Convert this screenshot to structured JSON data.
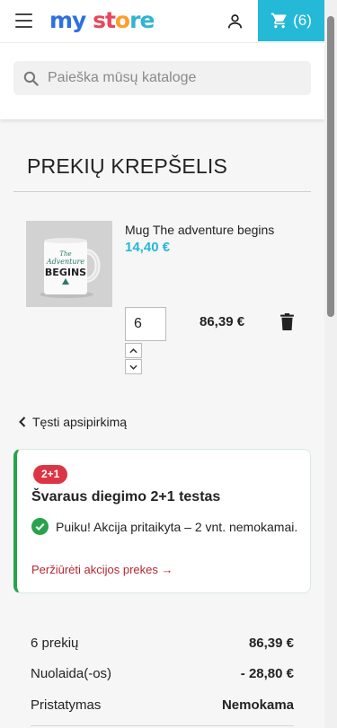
{
  "header": {
    "logo": {
      "part1": "my",
      "part2": "st",
      "part3": "o",
      "part4": "re"
    },
    "cart_count": "(6)",
    "search_placeholder": "Paieška mūsų kataloge"
  },
  "cart": {
    "title": "PREKIŲ KREPŠELIS",
    "items": [
      {
        "name": "Mug The adventure begins",
        "price": "14,40 €",
        "quantity": "6",
        "total": "86,39 €",
        "image_text": {
          "line1": "The",
          "line2": "Adventure",
          "line3": "BEGINS"
        }
      }
    ],
    "continue_label": "Tęsti apsipirkimą"
  },
  "promo": {
    "badge": "2+1",
    "title": "Švaraus diegimo 2+1 testas",
    "message": "Puiku! Akcija pritaikyta – 2 vnt. nemokamai.",
    "link": "Peržiūrėti akcijos prekes →"
  },
  "summary": {
    "rows": [
      {
        "label": "6 prekių",
        "value": "86,39 €"
      },
      {
        "label": "Nuolaida(-os)",
        "value": "- 28,80 €"
      },
      {
        "label": "Pristatymas",
        "value": "Nemokama"
      }
    ]
  },
  "colors": {
    "accent": "#24b9d7",
    "success": "#27a34b",
    "danger": "#dc3545",
    "link": "#b42632"
  },
  "icons": [
    "menu-icon",
    "user-icon",
    "cart-icon",
    "search-icon",
    "chevron-up-icon",
    "chevron-down-icon",
    "trash-icon",
    "chevron-left-icon",
    "check-circle-icon"
  ]
}
